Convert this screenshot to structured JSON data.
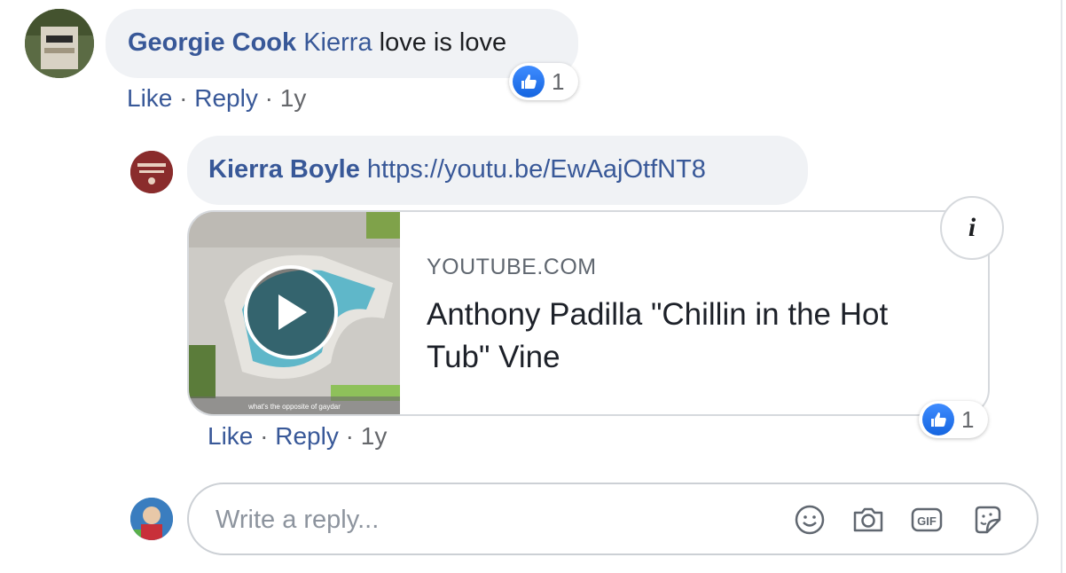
{
  "comment": {
    "author": "Georgie Cook",
    "mention": "Kierra",
    "text": "love is love",
    "reaction_count": "1",
    "actions": {
      "like": "Like",
      "reply": "Reply",
      "age": "1y",
      "separator": "·"
    }
  },
  "reply": {
    "author": "Kierra Boyle",
    "link": "https://youtu.be/EwAajOtfNT8",
    "reaction_count": "1",
    "actions": {
      "like": "Like",
      "reply": "Reply",
      "age": "1y",
      "separator": "·"
    },
    "preview": {
      "source": "YOUTUBE.COM",
      "title": "Anthony Padilla \"Chillin in the Hot Tub\" Vine",
      "thumbnail_caption": "what's the opposite of gaydar",
      "info_icon": "i"
    }
  },
  "composer": {
    "placeholder": "Write a reply...",
    "icons": [
      "emoji-icon",
      "camera-icon",
      "gif-icon",
      "sticker-icon"
    ]
  },
  "colors": {
    "name_link": "#385898",
    "bubble_bg": "#f0f2f5",
    "like_blue": "#1877f2",
    "muted": "#65676b"
  }
}
